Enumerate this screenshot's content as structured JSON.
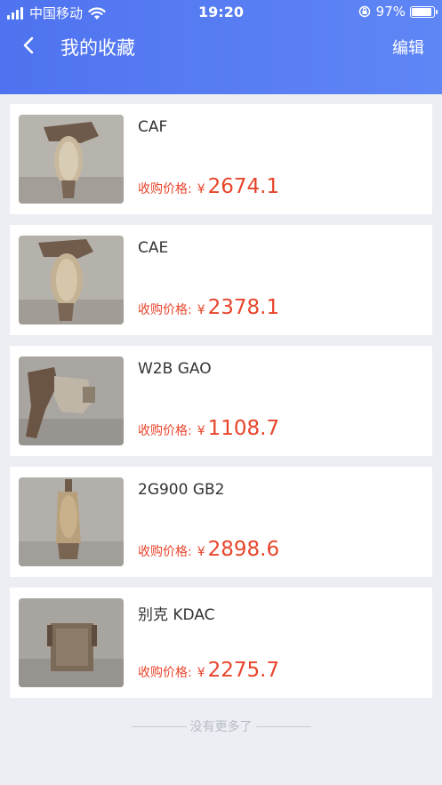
{
  "status_bar": {
    "carrier": "中国移动",
    "time": "19:20",
    "battery": "97%",
    "battery_level": 0.97
  },
  "nav": {
    "title": "我的收藏",
    "edit_label": "编辑",
    "back_icon": "chevron-left-icon"
  },
  "items": [
    {
      "name": "CAF",
      "price_label": "收购价格:",
      "currency": "¥",
      "price": "2674.1"
    },
    {
      "name": "CAE",
      "price_label": "收购价格:",
      "currency": "¥",
      "price": "2378.1"
    },
    {
      "name": "W2B GAO",
      "price_label": "收购价格:",
      "currency": "¥",
      "price": "1108.7"
    },
    {
      "name": "2G900 GB2",
      "price_label": "收购价格:",
      "currency": "¥",
      "price": "2898.6"
    },
    {
      "name": "别克 KDAC",
      "price_label": "收购价格:",
      "currency": "¥",
      "price": "2275.7"
    }
  ],
  "footer": {
    "text": "没有更多了"
  },
  "colors": {
    "header": "#5578f2",
    "price": "#e8452c",
    "background": "#eceef4"
  }
}
